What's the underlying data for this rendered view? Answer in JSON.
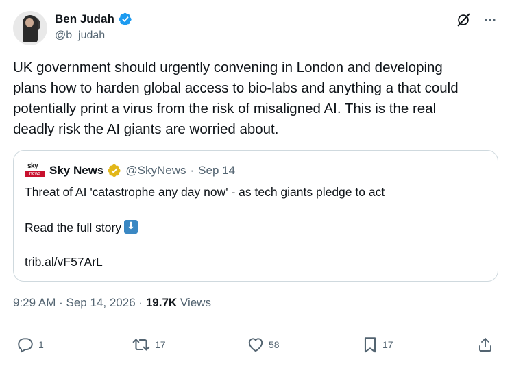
{
  "author": {
    "display_name": "Ben Judah",
    "handle": "@b_judah"
  },
  "icons": {
    "verified": "verified-badge-icon",
    "grok": "grok-icon",
    "more": "more-icon",
    "reply": "reply-icon",
    "retweet": "retweet-icon",
    "like": "like-icon",
    "bookmark": "bookmark-icon",
    "share": "share-icon",
    "down_arrow_emoji": "down-arrow-emoji-icon"
  },
  "tweet": {
    "lines": [
      "UK government should urgently convening in London and developing",
      "plans how to harden global access to bio-labs and anything a that could",
      "potentially print a virus from the risk of misaligned AI. This is the real",
      "deadly risk the AI giants are worried about."
    ]
  },
  "quote": {
    "logo_top": "sky",
    "logo_bottom": "news",
    "name": "Sky News",
    "handle": "@SkyNews",
    "separator": "·",
    "date": "Sep 14",
    "headline": "Threat of AI 'catastrophe any day now' - as tech giants pledge to act",
    "read_more": "Read the full story",
    "link": "trib.al/vF57ArL"
  },
  "meta": {
    "time": "9:29 AM",
    "separator": "·",
    "date": "Sep 14, 2026",
    "views_count": "19.7K",
    "views_label": "Views"
  },
  "actions": {
    "replies": "1",
    "reposts": "17",
    "likes": "58",
    "bookmarks": "17"
  },
  "colors": {
    "verified_blue": "#1d9bf0",
    "verified_gold": "#e2b719",
    "text": "#0f1419",
    "secondary": "#536471",
    "border": "#cfd9de",
    "sky_red": "#c8102e"
  }
}
